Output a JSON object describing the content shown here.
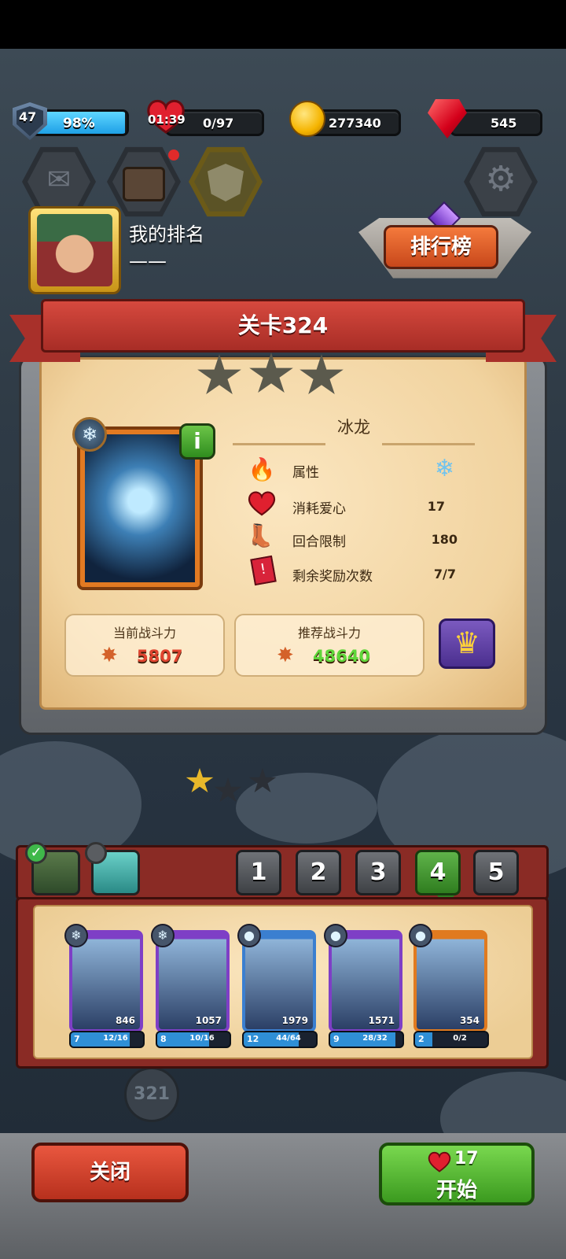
{
  "hud": {
    "level": "47",
    "xp_percent": "98%",
    "xp_fill": 0.98,
    "energy_timer": "01:39",
    "energy": "0/97",
    "coins": "277340",
    "gems": "545"
  },
  "profile": {
    "rank_title": "我的排名",
    "rank_value": "——",
    "leaderboard_label": "排行榜"
  },
  "stage": {
    "title": "关卡324",
    "stars_earned": 0,
    "stars_total": 3,
    "boss_name": "冰龙",
    "element_icon": "snowflake",
    "info_label": "i",
    "stats": [
      {
        "label": "属性",
        "value": "❄",
        "icon": "fire-ice-icon"
      },
      {
        "label": "消耗爱心",
        "value": "17",
        "icon": "heart-icon"
      },
      {
        "label": "回合限制",
        "value": "180",
        "icon": "boot-icon"
      },
      {
        "label": "剩余奖励次数",
        "value": "7/7",
        "icon": "reward-card-icon"
      }
    ],
    "current_power_label": "当前战斗力",
    "current_power": "5807",
    "recommended_power_label": "推荐战斗力",
    "recommended_power": "48640"
  },
  "map": {
    "node_label": "321"
  },
  "team": {
    "tabs": [
      "1",
      "2",
      "3",
      "4",
      "5"
    ],
    "active_tab": 3,
    "heroes": [
      {
        "power": "846",
        "level": "7",
        "progress": "12/16",
        "fill": 0.75,
        "element": "❄",
        "color": "#7e3fc6"
      },
      {
        "power": "1057",
        "level": "8",
        "progress": "10/16",
        "fill": 0.625,
        "element": "❄",
        "color": "#7e3fc6"
      },
      {
        "power": "1979",
        "level": "12",
        "progress": "44/64",
        "fill": 0.6875,
        "element": "●",
        "color": "#3b7fd0"
      },
      {
        "power": "1571",
        "level": "9",
        "progress": "28/32",
        "fill": 0.875,
        "element": "●",
        "color": "#7e3fc6"
      },
      {
        "power": "354",
        "level": "2",
        "progress": "0/2",
        "fill": 0.0,
        "element": "●",
        "color": "#e07a1f"
      }
    ]
  },
  "actions": {
    "close_label": "关闭",
    "start_label": "开始",
    "start_cost": "17"
  },
  "colors": {
    "ribbon": "#c23b32",
    "parchment": "#f4dbab",
    "current_power": "#e0432f",
    "recommended_power": "#5fd63a"
  }
}
